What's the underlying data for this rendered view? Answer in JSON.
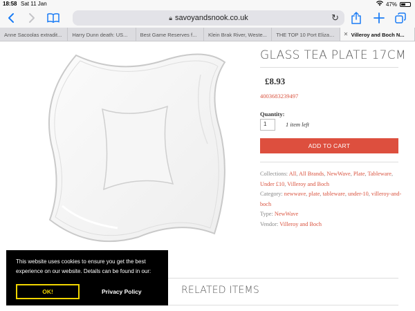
{
  "statusbar": {
    "time": "18:58",
    "date": "Sat 11 Jan",
    "battery": "47%"
  },
  "browser": {
    "url": "savoyandsnook.co.uk",
    "tabs": [
      {
        "label": "Anne Sacoolas extradit..."
      },
      {
        "label": "Harry Dunn death: US..."
      },
      {
        "label": "Best Game Reserves f..."
      },
      {
        "label": "Klein Brak River, Weste..."
      },
      {
        "label": "THE TOP 10 Port Elizab..."
      },
      {
        "label": "Villeroy and Boch N...",
        "active": true
      }
    ]
  },
  "product": {
    "title": "GLASS TEA PLATE 17CM",
    "price": "£8.93",
    "sku": "4003683239497",
    "quantity_label": "Quantity:",
    "quantity_value": "1",
    "stock": "1 item left",
    "add_to_cart": "ADD TO CART",
    "collections_label": "Collections:",
    "collections": [
      "All",
      "All Brands",
      "NewWave",
      "Plate",
      "Tableware",
      "Under £10",
      "Villeroy and Boch"
    ],
    "category_label": "Category:",
    "categories": [
      "newwave",
      "plate",
      "tableware",
      "under-10",
      "villeroy-and-boch"
    ],
    "type_label": "Type:",
    "type": "NewWave",
    "vendor_label": "Vendor:",
    "vendor": "Villeroy and Boch"
  },
  "related": {
    "title": "RELATED ITEMS"
  },
  "cookie": {
    "message": "This website uses cookies to ensure you get the best experience on our website. Details can be found in our:",
    "ok_label": "OK!",
    "privacy_label": "Privacy Policy"
  },
  "colors": {
    "accent": "#dd4f3e",
    "link": "#d9533f",
    "ios_blue": "#1a7cf5",
    "cookie_button": "#f1d600"
  }
}
